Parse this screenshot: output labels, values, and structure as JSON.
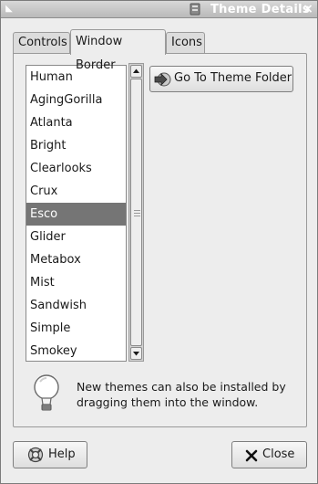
{
  "window": {
    "title": "Theme Details",
    "menu_glyph": "◣",
    "close_glyph": "×",
    "title_icon": "palette-icon"
  },
  "tabs": [
    {
      "label": "Controls",
      "active": false
    },
    {
      "label": "Window Border",
      "active": true
    },
    {
      "label": "Icons",
      "active": false
    }
  ],
  "theme_list": {
    "items": [
      "Human",
      "AgingGorilla",
      "Atlanta",
      "Bright",
      "Clearlooks",
      "Crux",
      "Esco",
      "Glider",
      "Metabox",
      "Mist",
      "Sandwish",
      "Simple",
      "Smokey"
    ],
    "selected": "Esco"
  },
  "folder_button": {
    "label": "Go To Theme Folder",
    "icon": "folder-go-icon"
  },
  "hint": {
    "text": "New themes can also be installed by dragging them into the window.",
    "icon": "lightbulb-icon"
  },
  "footer": {
    "help_label": "Help",
    "help_icon": "help-lifebuoy-icon",
    "close_label": "Close",
    "close_icon": "close-x-icon"
  },
  "colors": {
    "selection": "#757575",
    "title_text": "#ffffff"
  }
}
